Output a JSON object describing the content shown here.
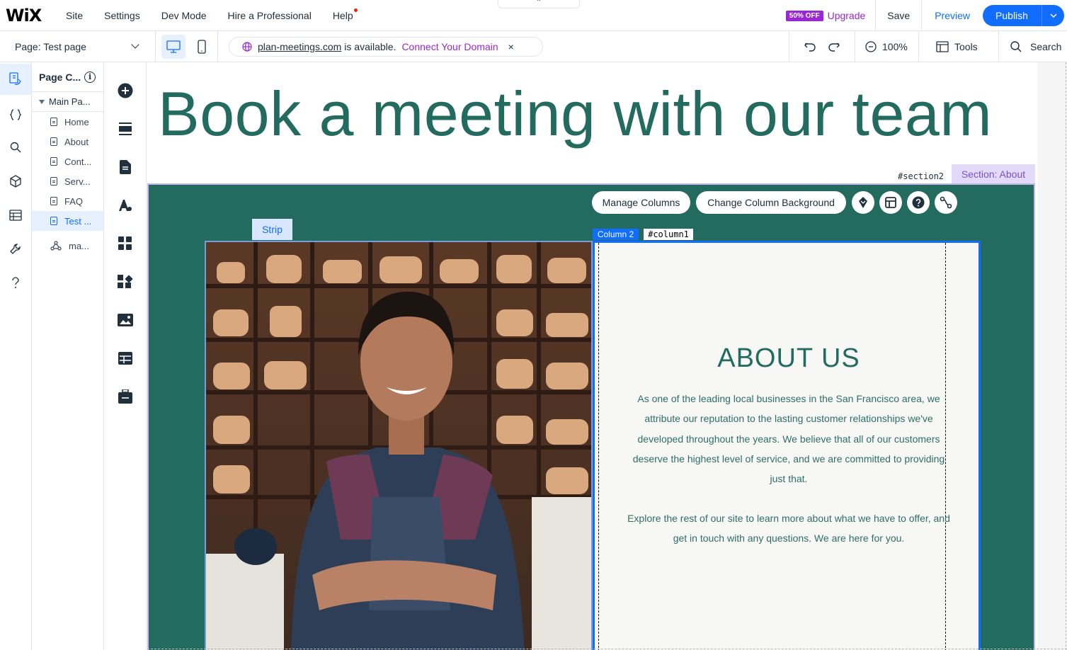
{
  "topbar": {
    "logo": "WiX",
    "menu": [
      "Site",
      "Settings",
      "Dev Mode",
      "Hire a Professional",
      "Help"
    ],
    "badge": "50% OFF",
    "upgrade": "Upgrade",
    "save": "Save",
    "preview": "Preview",
    "publish": "Publish",
    "handle_glyph": "⌃"
  },
  "subbar": {
    "page_label": "Page: Test page",
    "domain_name": "plan-meetings.com",
    "domain_status": "is available.",
    "connect": "Connect Your Domain",
    "close_glyph": "×",
    "zoom": "100%",
    "tools": "Tools",
    "search": "Search"
  },
  "pages_panel": {
    "title": "Page C...",
    "info_glyph": "i",
    "group": "Main Pa...",
    "items": [
      "Home",
      "About",
      "Cont...",
      "Serv...",
      "FAQ",
      "Test ..."
    ],
    "extra": "ma..."
  },
  "canvas": {
    "heading": "Book a meeting with our team",
    "section_id": "#section2",
    "section_label": "Section: About",
    "manage_columns": "Manage Columns",
    "change_bg": "Change Column Background",
    "strip": "Strip",
    "column2_tag": "Column 2",
    "column1_id": "#column1",
    "about_title": "ABOUT US",
    "about_p1": "As one of the leading local businesses in the San Francisco area, we attribute our reputation to the lasting customer relationships we've developed throughout the years. We believe that all of our customers deserve the highest level of service, and we are committed to providing just that.",
    "about_p2": "Explore the rest of our site to learn more about what we have to offer, and get in touch with any questions. We are here for you."
  },
  "colors": {
    "accent": "#116dff",
    "brand_purple": "#9a27d5",
    "section_green": "#236b5f",
    "section_label_bg": "#e3d9f9"
  },
  "icons": {
    "rail": [
      "pages-icon",
      "code-icon",
      "search-icon",
      "package-icon",
      "table-icon",
      "wrench-icon",
      "question-icon"
    ],
    "tools": [
      "add-icon",
      "sections-icon",
      "page-icon",
      "theme-icon",
      "apps-icon",
      "integrations-icon",
      "media-icon",
      "cms-icon",
      "business-icon"
    ]
  }
}
